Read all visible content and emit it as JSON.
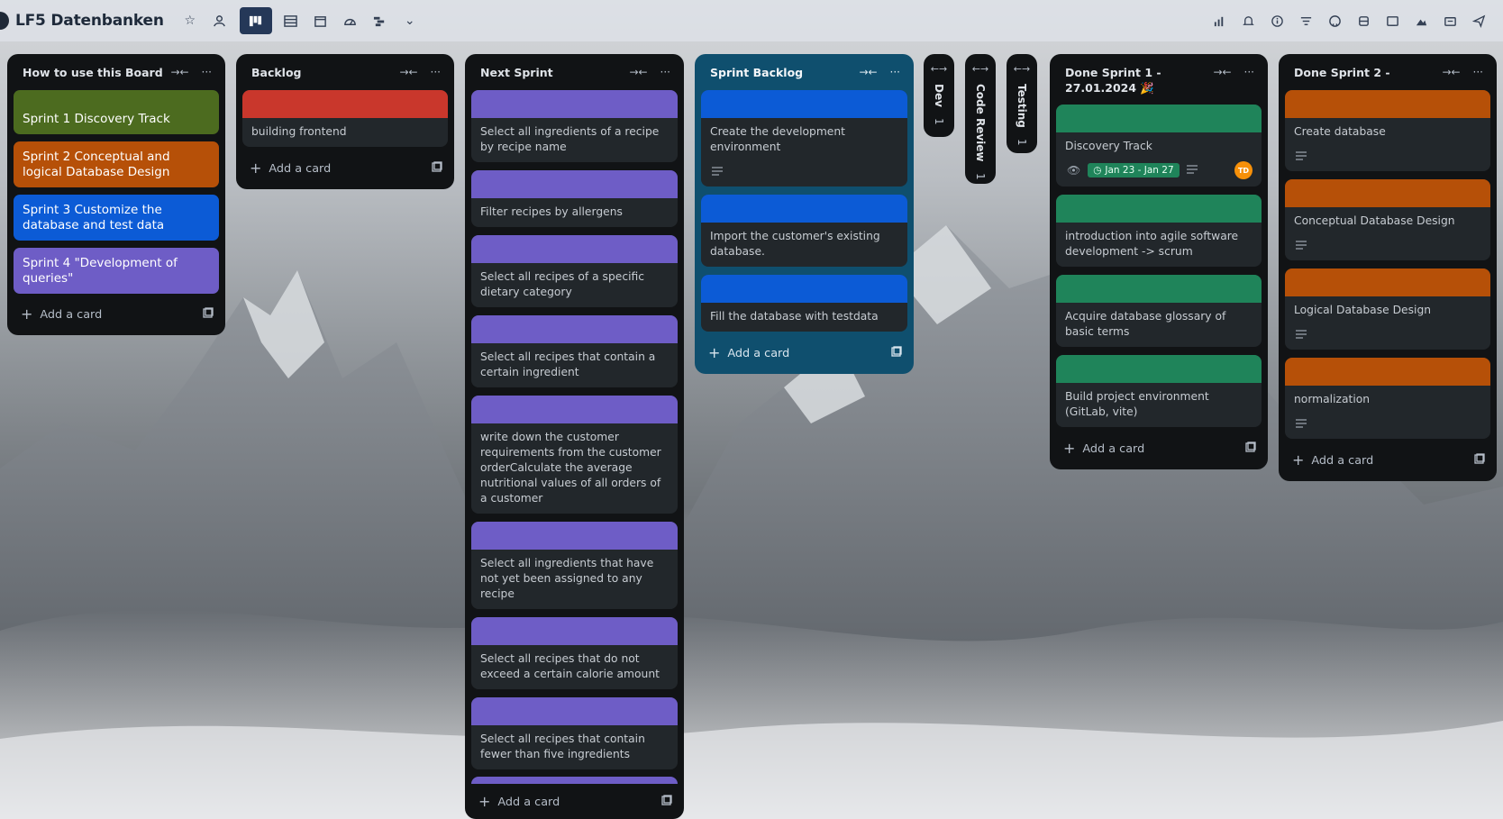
{
  "header": {
    "board_title": "LF5 Datenbanken"
  },
  "lists": [
    {
      "title": "How to use this Board",
      "color_cards": [
        {
          "label": "Sprint 1 Discovery Track",
          "color": "#4c6b1f"
        },
        {
          "label": "Sprint 2 Conceptual and logical Database Design",
          "color": "#b65008"
        },
        {
          "label": "Sprint 3 Customize the database and test data",
          "color": "#0c5bd6"
        },
        {
          "label": "Sprint 4 \"Development of queries\"",
          "color": "#6e5dc6"
        }
      ],
      "add_card": "Add a card"
    },
    {
      "title": "Backlog",
      "cards": [
        {
          "text": "building frontend",
          "cover": "#c9372c"
        }
      ],
      "add_card": "Add a card"
    },
    {
      "title": "Next Sprint",
      "cards": [
        {
          "text": "Select all ingredients of a recipe by recipe name",
          "cover": "#6e5dc6"
        },
        {
          "text": "Filter recipes by allergens",
          "cover": "#6e5dc6"
        },
        {
          "text": "Select all recipes of a specific dietary category",
          "cover": "#6e5dc6"
        },
        {
          "text": "Select all recipes that contain a certain ingredient",
          "cover": "#6e5dc6"
        },
        {
          "text": "write down the customer requirements from the customer orderCalculate the average nutritional values of all orders of a customer",
          "cover": "#6e5dc6"
        },
        {
          "text": "Select all ingredients that have not yet been assigned to any recipe",
          "cover": "#6e5dc6"
        },
        {
          "text": "Select all recipes that do not exceed a certain calorie amount",
          "cover": "#6e5dc6"
        },
        {
          "text": "Select all recipes that contain fewer than five ingredients",
          "cover": "#6e5dc6"
        }
      ],
      "add_card": "Add a card"
    },
    {
      "title": "Sprint Backlog",
      "cards": [
        {
          "text": "Create the development environment",
          "cover": "#0c5bd6"
        },
        {
          "text": "Import the customer's existing database.",
          "cover": "#0c5bd6"
        },
        {
          "text": "Fill the database with testdata",
          "cover": "#0c5bd6"
        }
      ],
      "add_card": "Add a card"
    },
    {
      "title": "Dev",
      "count": "1"
    },
    {
      "title": "Code Review",
      "count": "1"
    },
    {
      "title": "Testing",
      "count": "1"
    },
    {
      "title": "Done Sprint 1 - 27.01.2024 🎉",
      "cards": [
        {
          "text": "Discovery Track",
          "cover": "#1f845a",
          "date": "Jan 23 - Jan 27",
          "avatar": "TD"
        },
        {
          "text": "introduction into agile software development -> scrum",
          "cover": "#1f845a"
        },
        {
          "text": "Acquire database glossary of basic terms",
          "cover": "#1f845a"
        },
        {
          "text": "Build project environment (GitLab, vite)",
          "cover": "#1f845a"
        }
      ],
      "add_card": "Add a card"
    },
    {
      "title": "Done Sprint 2 -",
      "cards": [
        {
          "text": "Create database",
          "cover": "#b65008"
        },
        {
          "text": "Conceptual Database Design",
          "cover": "#b65008"
        },
        {
          "text": "Logical Database Design",
          "cover": "#b65008"
        },
        {
          "text": "normalization",
          "cover": "#b65008"
        }
      ],
      "add_card": "Add a card"
    }
  ],
  "icons": {
    "header_left": [
      "star-icon",
      "people-icon",
      "board-icon",
      "table-icon",
      "calendar-icon",
      "dashboard-icon",
      "timeline-icon",
      "chevron-down-icon"
    ],
    "header_right": [
      "chart-icon",
      "bell-icon",
      "info-icon",
      "filter-icon",
      "github-icon",
      "database-icon",
      "card-icon",
      "custom-icon",
      "share-icon",
      "send-icon"
    ]
  }
}
